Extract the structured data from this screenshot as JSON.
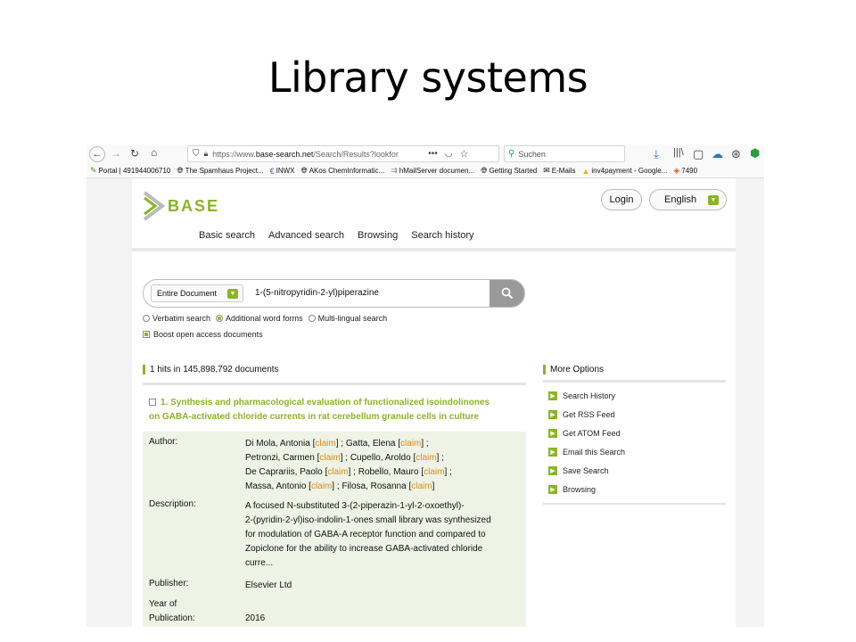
{
  "slide": {
    "title": "Library systems"
  },
  "browser": {
    "url_prefix": "https://www.",
    "url_domain": "base-search.net",
    "url_rest": "/Search/Results?lookfor",
    "search_placeholder": "Suchen",
    "bookmarks": [
      "Portal | 491944006710",
      "The Spamhaus Project...",
      "INWX",
      "AKos ChemInformatic...",
      "hMailServer documen...",
      "Getting Started",
      "E-Mails",
      "inv4payment - Google...",
      "7490"
    ]
  },
  "site": {
    "logo_text": "BASE",
    "login_label": "Login",
    "language_label": "English",
    "nav": [
      "Basic search",
      "Advanced search",
      "Browsing",
      "Search history"
    ]
  },
  "search": {
    "scope_label": "Entire Document",
    "query": "1-(5-nitropyridin-2-yl)piperazine",
    "options": [
      "Verbatim search",
      "Additional word forms",
      "Multi-lingual search"
    ],
    "boost_label": "Boost open access documents"
  },
  "results": {
    "hits_text": "1 hits in 145,898,792 documents",
    "item": {
      "title_line1": "1. Synthesis and pharmacological evaluation of functionalized isoindolinones",
      "title_line2": "on GABA-activated chloride currents in rat cerebellum granule cells in culture",
      "author_label": "Author:",
      "authors": [
        [
          "Di Mola, Antonia ",
          "claim",
          " ; Gatta, Elena ",
          "claim",
          " ;"
        ],
        [
          "Petronzi, Carmen ",
          "claim",
          " ; Cupello, Aroldo ",
          "claim",
          " ;"
        ],
        [
          "De Caprariis, Paolo ",
          "claim",
          " ; Robello, Mauro ",
          "claim",
          " ;"
        ],
        [
          "Massa, Antonio ",
          "claim",
          " ; Filosa, Rosanna ",
          "claim",
          ""
        ]
      ],
      "description_label": "Description:",
      "description": [
        "A focused N-substituted 3-(2-piperazin-1-yl-2-oxoethyl)-",
        "2-(pyridin-2-yl)iso-indolin-1-ones small library was synthesized",
        "for modulation of GABA-A receptor function and compared to",
        "Zopiclone for the ability to increase GABA-activated chloride",
        "curre..."
      ],
      "publisher_label": "Publisher:",
      "publisher": "Elsevier Ltd",
      "year_label_1": "Year of",
      "year_label_2": "Publication:",
      "year": "2016"
    }
  },
  "more_options": {
    "heading": "More Options",
    "items": [
      "Search History",
      "Get RSS Feed",
      "Get ATOM Feed",
      "Email this Search",
      "Save Search",
      "Browsing"
    ]
  },
  "colors": {
    "accent": "#8ab523",
    "claim": "#d98c1f"
  }
}
